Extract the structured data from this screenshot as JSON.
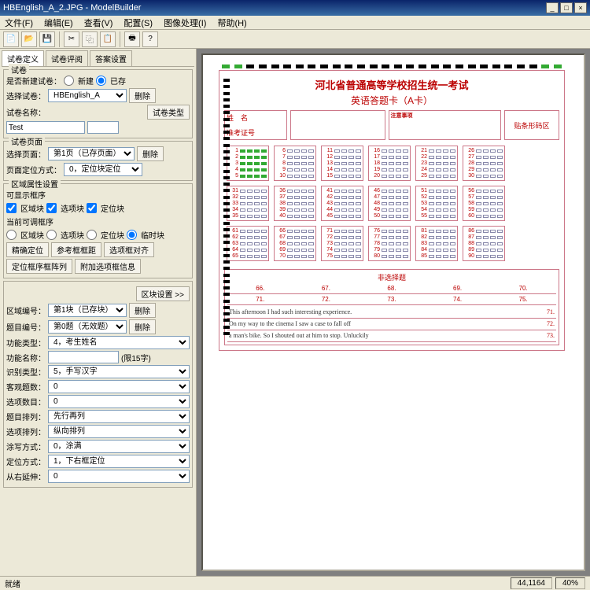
{
  "titlebar": {
    "title": "HBEnglish_A_2.JPG - ModelBuilder"
  },
  "window": {
    "min": "_",
    "max": "□",
    "close": "×"
  },
  "menu": {
    "file": "文件(F)",
    "edit": "编辑(E)",
    "view": "查看(V)",
    "config": "配置(S)",
    "imgproc": "图像处理(I)",
    "help": "帮助(H)"
  },
  "tabs": {
    "t1": "试卷定义",
    "t2": "试卷评阅",
    "t3": "答案设置"
  },
  "group1": {
    "title": "试卷",
    "lbl_newpaper": "是否新建试卷：",
    "opt_new": "新建",
    "opt_exist": "已存",
    "lbl_select": "选择试卷：",
    "val_select": "HBEnglish_A",
    "btn_del": "删除",
    "lbl_name": "试卷名称：",
    "val_name": "Test",
    "btn_papertype": "试卷类型"
  },
  "group2": {
    "title": "试卷页面",
    "lbl_page": "选择页面：",
    "val_page": "第1页（已存页面）",
    "btn_del": "删除",
    "lbl_posmode": "页面定位方式：",
    "val_posmode": "0，定位块定位"
  },
  "group3": {
    "title": "区域属性设置",
    "lbl_showframe": "可显示框序",
    "chk_region": "区域块",
    "chk_optblk": "选项块",
    "chk_locblk": "定位块",
    "lbl_adjust": "当前可调框序",
    "rad_region": "区域块",
    "rad_optblk": "选项块",
    "rad_locblk": "定位块",
    "rad_temp": "临时块",
    "btn_precise": "精确定位",
    "btn_refframe": "参考框框距",
    "btn_optalign": "选项框对齐",
    "btn_locseq": "定位框序框阵列",
    "btn_addopt": "附加选项框信息"
  },
  "group4": {
    "btn_regset": "区块设置 >>",
    "lbl_regnum": "区域编号：",
    "val_regnum": "第1块（已存块）",
    "btn_del": "删除",
    "lbl_qnum": "题目编号：",
    "val_qnum": "第0题（无效题）",
    "btn_del2": "删除",
    "lbl_functype": "功能类型：",
    "val_functype": "4，考生姓名",
    "lbl_funcname": "功能名称：",
    "val_funcname": "",
    "hint": "(限15字)",
    "lbl_rectype": "识别类型：",
    "val_rectype": "5，手写汉字",
    "lbl_objcnt": "客观题数：",
    "val_objcnt": "0",
    "lbl_optcnt": "选项数目：",
    "val_optcnt": "0",
    "lbl_qarr": "题目排列：",
    "val_qarr": "先行再列",
    "lbl_optarr": "选项排列：",
    "val_optarr": "纵向排列",
    "lbl_scoremode": "涂写方式：",
    "val_scoremode": "0，涂满",
    "lbl_locmode": "定位方式：",
    "val_locmode": "1，下右框定位",
    "lbl_extend": "从右延伸：",
    "val_extend": "0"
  },
  "sheet": {
    "title": "河北省普通高等学校招生统一考试",
    "subtitle": "英语答题卡（A卡）",
    "name_lbl": "姓　名",
    "exam_lbl": "准考证号",
    "attn_title": "注意事项",
    "barcode": "贴条形码区",
    "essay_title": "非选择题",
    "essay_nums": [
      "66.",
      "67.",
      "68.",
      "69.",
      "70."
    ],
    "essay_nums2": [
      "71.",
      "72.",
      "73.",
      "74.",
      "75."
    ],
    "essay_line1": "This afternoon I had such interesting experience.",
    "essay_line2": "On my way to the cinema I saw a case to fall off",
    "essay_line3": "a man's bike. So I shouted out at him to stop. Unluckily",
    "essay_n71": "71.",
    "essay_n72": "72.",
    "essay_n73": "73."
  },
  "statusbar": {
    "ready": "就绪",
    "coords": "44,1164",
    "zoom": "40%"
  }
}
